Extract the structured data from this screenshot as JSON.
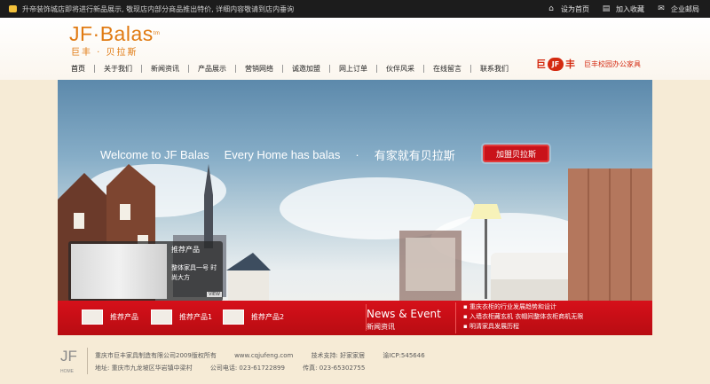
{
  "topbar": {
    "notice": "升帝装饰城店即将进行新品展示, 敬现店内部分商品推出特价, 详细内容敬请到店内垂询",
    "links": [
      {
        "label": "设为首页",
        "icon": "home-icon"
      },
      {
        "label": "加入收藏",
        "icon": "bookmark-icon"
      },
      {
        "label": "企业邮局",
        "icon": "mail-icon"
      }
    ]
  },
  "logo": {
    "en": "JF·Balas",
    "tm": "tm",
    "cn": "巨丰 · 贝拉斯"
  },
  "nav": [
    "首页",
    "关于我们",
    "新闻资讯",
    "产品展示",
    "营销网络",
    "诚邀加盟",
    "网上订单",
    "伙伴风采",
    "在线留言",
    "联系我们"
  ],
  "promo": {
    "mark1": "巨",
    "mark2": "丰",
    "text": "巨丰校园办公家具"
  },
  "banner": {
    "headline": [
      "Welcome to JF Balas",
      "Every Home has balas",
      "·",
      "有家就有贝拉斯"
    ],
    "join_button": "加盟贝拉斯",
    "rec_title": "推荐产品",
    "rec_sub": "整体家具一号 时尚大方",
    "rec_view": "VIEW"
  },
  "redbar": {
    "products": [
      "推荐产品",
      "推荐产品1",
      "推荐产品2"
    ],
    "news_title": "News & Event",
    "news_sub": "新闻资讯",
    "news_items": [
      "▪ 重庆衣柜的行业发展趋势和设计",
      "▪ 入墙衣柜藏玄机 衣帽间整体衣柜商机无限",
      "▪ 明清家具发展历程"
    ]
  },
  "footer": {
    "logo": "JF",
    "logo_sub": "HOME",
    "line1": [
      "重庆市巨丰家具制造有限公司2009版权所有",
      "www.cqjufeng.com",
      "技术支持: 好家家居",
      "渝ICP:545646"
    ],
    "line2": [
      "地址: 重庆市九龙坡区华岩镇中梁村",
      "公司电话: 023-61722899",
      "传真: 023-65302755"
    ]
  }
}
